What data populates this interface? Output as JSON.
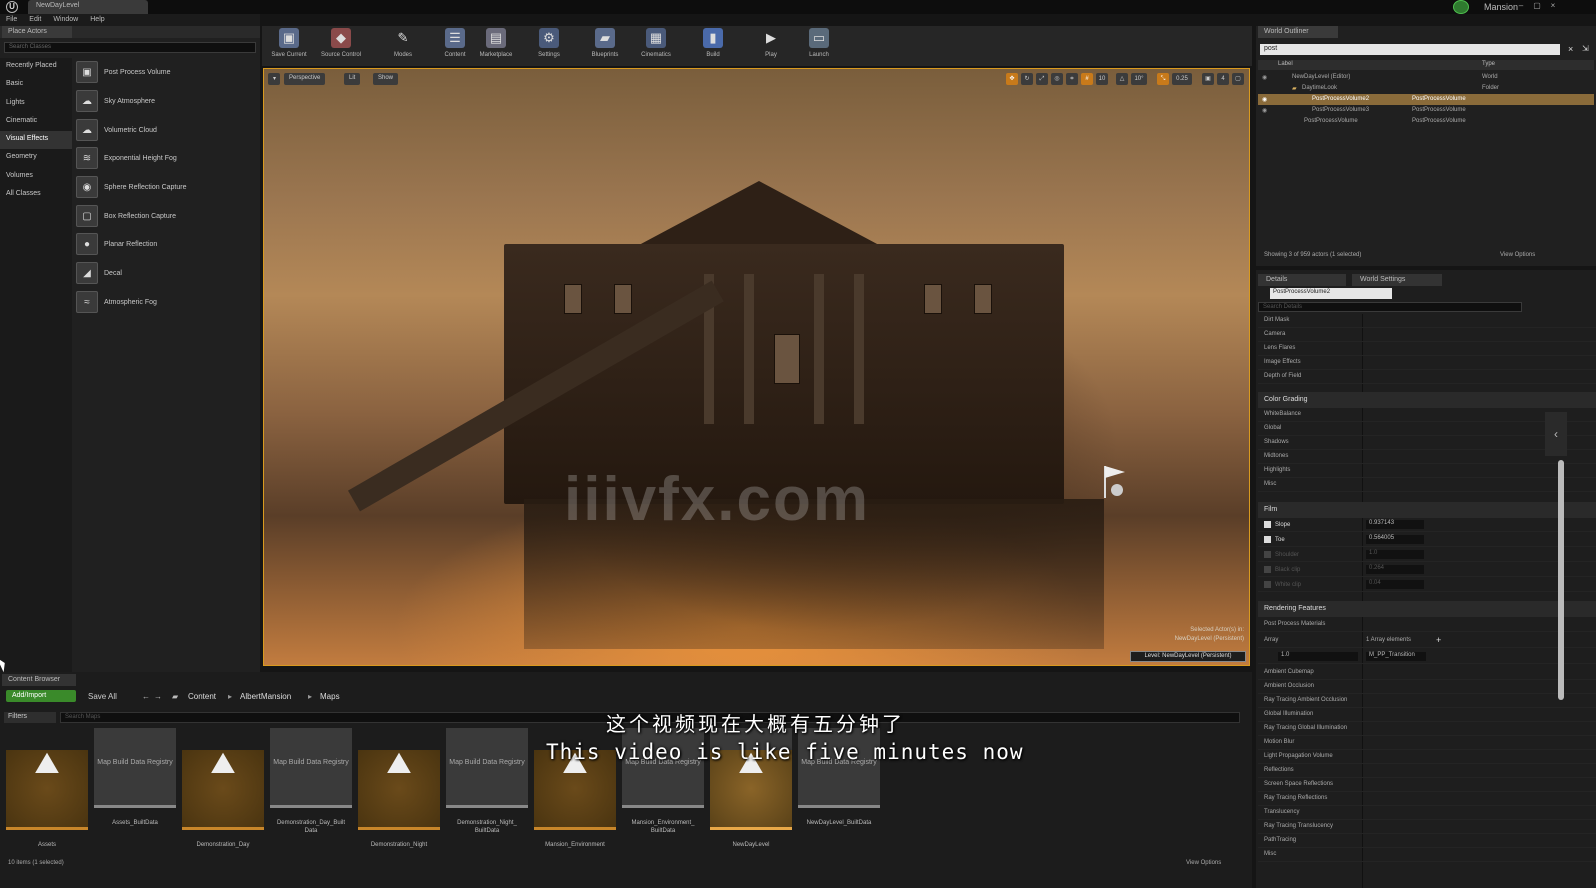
{
  "titlebar": {
    "document_tab": "NewDayLevel",
    "project": "Mansion",
    "minimize": "–",
    "restore": "▢",
    "close": "×"
  },
  "menu": [
    "File",
    "Edit",
    "Window",
    "Help"
  ],
  "place_actors": {
    "tab": "Place Actors",
    "search_placeholder": "Search Classes",
    "categories": [
      "Recently Placed",
      "Basic",
      "Lights",
      "Cinematic",
      "Visual Effects",
      "Geometry",
      "Volumes",
      "All Classes"
    ],
    "items": [
      "Post Process Volume",
      "Sky Atmosphere",
      "Volumetric Cloud",
      "Exponential Height Fog",
      "Sphere Reflection Capture",
      "Box Reflection Capture",
      "Planar Reflection",
      "Decal",
      "Atmospheric Fog"
    ]
  },
  "toolbar": [
    "Save Current",
    "Source Control",
    "Modes",
    "Content",
    "Marketplace",
    "Settings",
    "Blueprints",
    "Cinematics",
    "Build",
    "Play",
    "Launch"
  ],
  "viewport": {
    "perspective": "Perspective",
    "lit": "Lit",
    "show": "Show",
    "grid_snap": "10",
    "rot_snap": "10°",
    "scale_snap": "0.25",
    "cam_speed": "4",
    "selected_line1": "Selected Actor(s) in:",
    "selected_line2": "NewDayLevel (Persistent)",
    "level": "Level: NewDayLevel (Persistent)",
    "watermark": "iiivfx.com"
  },
  "outliner": {
    "tab": "World Outliner",
    "search_value": "post",
    "col_label": "Label",
    "col_type": "Type",
    "rows": [
      {
        "label": "NewDayLevel (Editor)",
        "type": "World"
      },
      {
        "label": "DaytimeLook",
        "type": "Folder"
      },
      {
        "label": "PostProcessVolume2",
        "type": "PostProcessVolume"
      },
      {
        "label": "PostProcessVolume3",
        "type": "PostProcessVolume"
      },
      {
        "label": "PostProcessVolume",
        "type": "PostProcessVolume"
      }
    ],
    "status": "Showing 3 of 959 actors (1 selected)",
    "view_options": "View Options"
  },
  "details": {
    "tab_details": "Details",
    "tab_world_settings": "World Settings",
    "actor_name": "PostProcessVolume2",
    "search_placeholder": "Search Details",
    "top_rows": [
      "Dirt Mask",
      "Camera",
      "Lens Flares",
      "Image Effects",
      "Depth of Field"
    ],
    "color_grading": "Color Grading",
    "color_rows": [
      "WhiteBalance",
      "Global",
      "Shadows",
      "Midtones",
      "Highlights",
      "Misc"
    ],
    "film": "Film",
    "film_rows": [
      {
        "label": "Slope",
        "value": "0.937143"
      },
      {
        "label": "Toe",
        "value": "0.564005"
      },
      {
        "label": "Shoulder",
        "value": "1.0"
      },
      {
        "label": "Black clip",
        "value": "0.264"
      },
      {
        "label": "White clip",
        "value": "0.04"
      }
    ],
    "rendering_features": "Rendering Features",
    "ppm": "Post Process Materials",
    "array": "Array",
    "array_elements": "1 Array elements",
    "array_value": "1.0",
    "array_material": "M_PP_Transition",
    "rendering_rows": [
      "Ambient Cubemap",
      "Ambient Occlusion",
      "Ray Tracing Ambient Occlusion",
      "Global Illumination",
      "Ray Tracing Global Illumination",
      "Motion Blur",
      "Light Propagation Volume",
      "Reflections",
      "Screen Space Reflections",
      "Ray Tracing Reflections",
      "Translucency",
      "Ray Tracing Translucency",
      "PathTracing",
      "Misc"
    ]
  },
  "content_browser": {
    "tab": "Content Browser",
    "add_import": "Add/Import",
    "save_all": "Save All",
    "crumbs": [
      "Content",
      "AlbertMansion",
      "Maps"
    ],
    "filters": "Filters",
    "search_placeholder": "Search Maps",
    "registry_text": "Map Build Data Registry",
    "tiles": [
      {
        "name": "Assets",
        "kind": "level"
      },
      {
        "name": "Assets_BuiltData",
        "kind": "registry"
      },
      {
        "name": "Demonstration_Day",
        "kind": "level"
      },
      {
        "name": "Demonstration_Day_Built Data",
        "kind": "registry"
      },
      {
        "name": "Demonstration_Night",
        "kind": "level"
      },
      {
        "name": "Demonstration_Night_ BuiltData",
        "kind": "registry"
      },
      {
        "name": "Mansion_Environment",
        "kind": "level"
      },
      {
        "name": "Mansion_Environment_ BuiltData",
        "kind": "registry"
      },
      {
        "name": "NewDayLevel",
        "kind": "selected"
      },
      {
        "name": "NewDayLevel_BuiltData",
        "kind": "registry"
      }
    ],
    "status": "10 items (1 selected)",
    "view_options": "View Options"
  },
  "subtitles": {
    "chinese": "这个视频现在大概有五分钟了",
    "english": "This video is like five minutes now"
  }
}
